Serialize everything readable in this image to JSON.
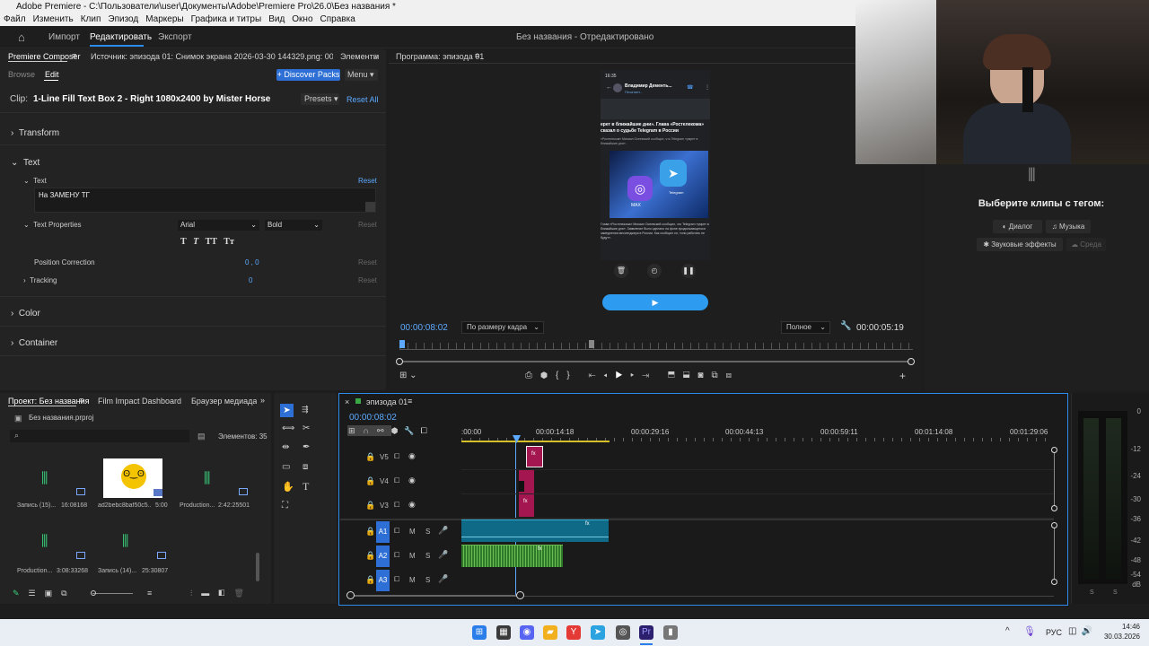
{
  "window": {
    "title": "Adobe Premiere - C:\\Пользователи\\user\\Документы\\Adobe\\Premiere Pro\\26.0\\Без названия *",
    "logo": "Pr"
  },
  "menu": [
    "Файл",
    "Изменить",
    "Клип",
    "Эпизод",
    "Маркеры",
    "Графика и титры",
    "Вид",
    "Окно",
    "Справка"
  ],
  "header": {
    "home_icon": "home-icon",
    "import": "Импорт",
    "edit": "Редактировать",
    "export": "Экспорт",
    "project_status": "Без названия - Отредактировано"
  },
  "left_panel": {
    "tab_composer": "Premiere Composer",
    "tab_source": "Источник: эпизода 01: Снимок экрана 2026-03-30 144329.png: 00:00:05:14",
    "tab_elements": "Элементы",
    "browse": "Browse",
    "edit": "Edit",
    "discover": "+ Discover Packs",
    "menu": "Menu",
    "clip_prefix": "Clip:",
    "clip_name": "1-Line Fill Text Box 2 - Right 1080x2400 by Mister Horse",
    "presets": "Presets",
    "reset_all": "Reset All",
    "transform": "Transform",
    "text_section": "Text",
    "text_label": "Text",
    "reset": "Reset",
    "text_value": "На ЗАМЕНУ ТГ",
    "text_props": "Text Properties",
    "font": "Arial",
    "weight": "Bold",
    "style_buttons": [
      "T",
      "T",
      "TT",
      "Tт"
    ],
    "position_correction": "Position Correction",
    "pos_value": "0 , 0",
    "tracking": "Tracking",
    "tracking_value": "0",
    "color": "Color",
    "container": "Container"
  },
  "program": {
    "tab": "Программа: эпизода 01",
    "phone": {
      "time": "16:35",
      "name": "Владимир Дементь...",
      "subtitle": "Печатает...",
      "headline": "ерет в ближайшие дни». Глава «Ростелекома» сказал о судьбе Telegram в России",
      "caption": "«Ростелеком» Михаил Осеевский сообщил, что Telegram «умрет в ближайшие дни».",
      "body": "Глава «Ростелекома» Михаил Осеевский сообщил, что Telegram «умрет в ближайшие дни». Заявление было сделано на фоне продолжающегося замедления мессенджера в России. Как сообщил он, «они работать не будут».",
      "max_label": "MAX",
      "tg_label": "Telegram"
    },
    "timecode_left": "00:00:08:02",
    "fit": "По размеру кадра",
    "quality": "Полное",
    "timecode_right": "00:00:05:19"
  },
  "right_panel": {
    "title": "Выберите клипы с тегом:",
    "tags": [
      "Диалог",
      "Музыка",
      "Звуковые эффекты",
      "Среда"
    ]
  },
  "project_panel": {
    "tab_project": "Проект: Без названия",
    "tab_film": "Film Impact Dashboard",
    "tab_browser": "Браузер медиаданны",
    "file": "Без названия.prproj",
    "items_count": "Элементов: 35",
    "items": [
      {
        "name": "Запись (15)...",
        "duration": "16:08168",
        "type": "audio"
      },
      {
        "name": "ad2bebc8baf50c5...",
        "duration": "5:00",
        "type": "image"
      },
      {
        "name": "Production...",
        "duration": "2:42:25501",
        "type": "audio"
      },
      {
        "name": "Production...",
        "duration": "3:08:33268",
        "type": "audio"
      },
      {
        "name": "Запись (14)...",
        "duration": "25:30807",
        "type": "audio"
      }
    ]
  },
  "timeline": {
    "tab": "эпизода 01",
    "timecode": "00:00:08:02",
    "ruler": [
      ":00:00",
      "00:00:14:18",
      "00:00:29:16",
      "00:00:44:13",
      "00:00:59:11",
      "00:01:14:08",
      "00:01:29:06"
    ],
    "video_tracks": [
      "V5",
      "V4",
      "V3"
    ],
    "audio_tracks": [
      "A1",
      "A2",
      "A3"
    ],
    "audio_mute": "M",
    "audio_solo": "S"
  },
  "meter": {
    "labels": [
      "0",
      "-12",
      "-24",
      "-30",
      "-36",
      "-42",
      "-48",
      "-54",
      "dB"
    ],
    "channels": [
      "S",
      "S"
    ]
  },
  "taskbar": {
    "lang": "РУС",
    "time": "14:46",
    "date": "30.03.2026"
  },
  "colors": {
    "accent": "#2d8ceb",
    "video_clip": "#a3164f",
    "audio_clip_a1": "#0e6a86",
    "audio_clip_a2": "#4a9a3a",
    "playhead": "#5ca9ff"
  }
}
